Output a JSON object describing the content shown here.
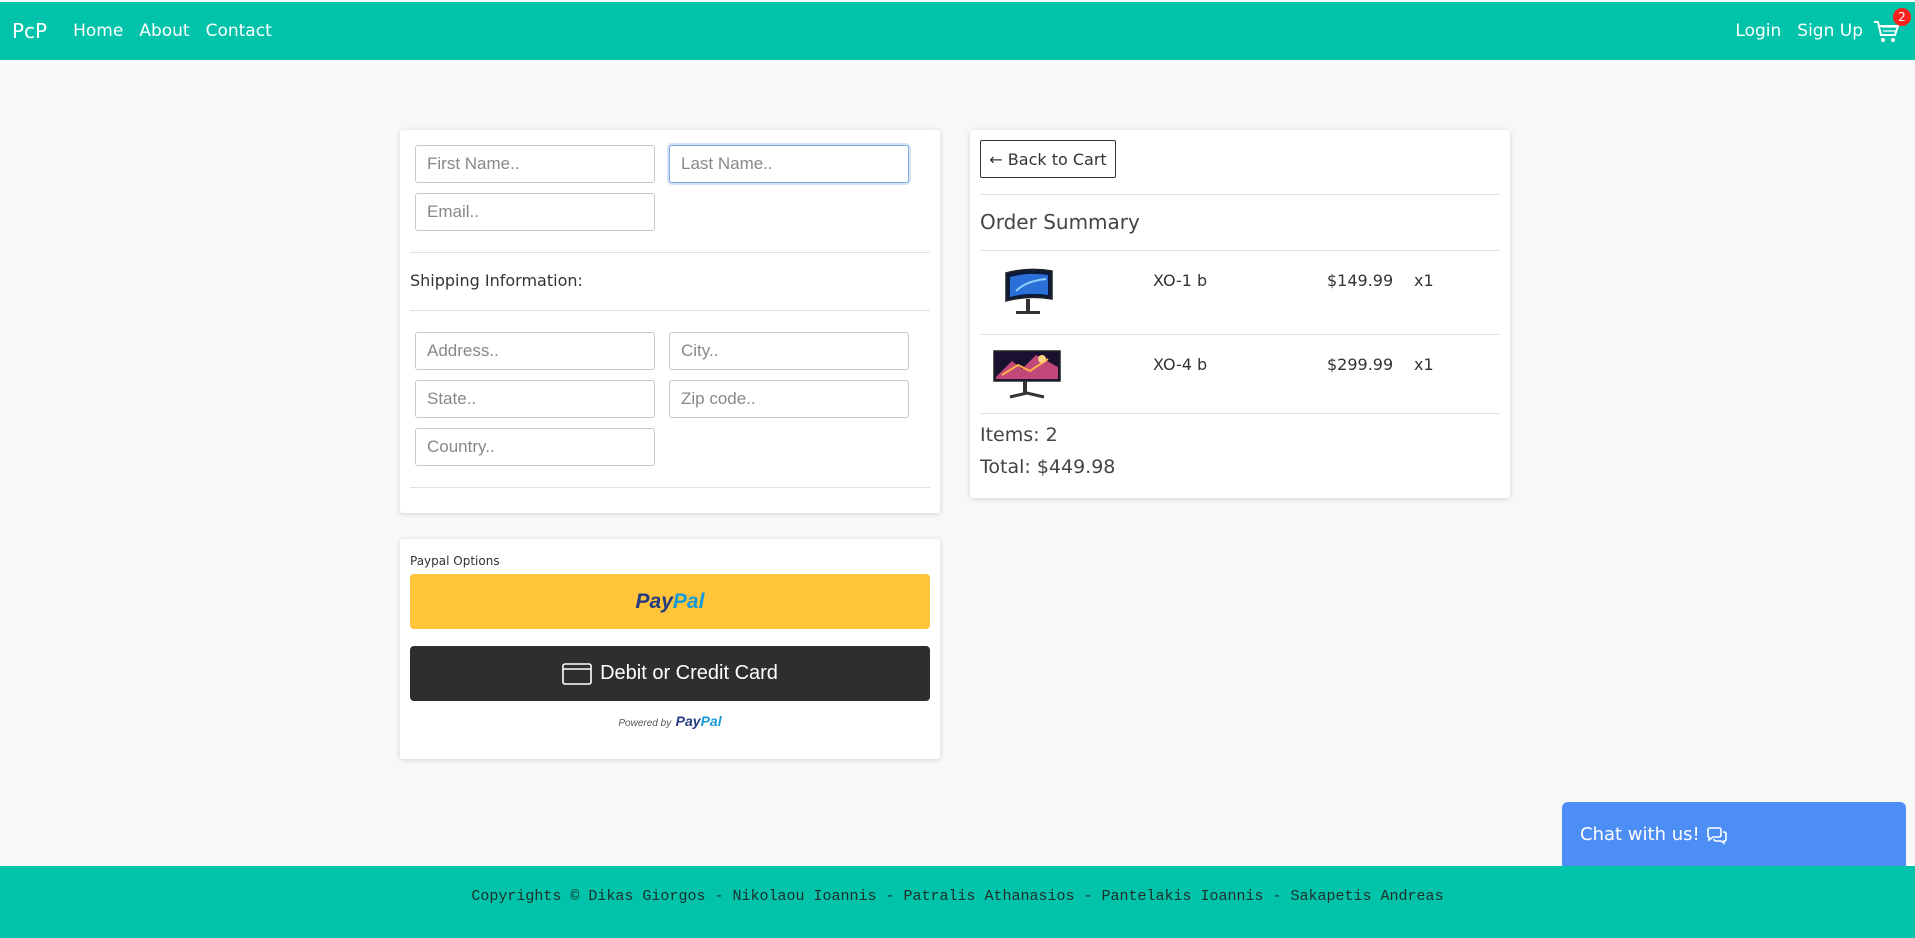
{
  "navbar": {
    "brand": "PcP",
    "links": [
      "Home",
      "About",
      "Contact"
    ],
    "right_links": [
      "Login",
      "Sign Up"
    ],
    "cart_icon": "cart-icon",
    "cart_count": "2"
  },
  "form": {
    "first_name_placeholder": "First Name..",
    "last_name_placeholder": "Last Name..",
    "email_placeholder": "Email..",
    "shipping_title": "Shipping Information:",
    "address_placeholder": "Address..",
    "city_placeholder": "City..",
    "state_placeholder": "State..",
    "zip_placeholder": "Zip code..",
    "country_placeholder": "Country.."
  },
  "payment": {
    "label": "Paypal Options",
    "paypal_part1": "Pay",
    "paypal_part2": "Pal",
    "card_button": "Debit or Credit Card",
    "powered_by": "Powered by",
    "powered_part1": "Pay",
    "powered_part2": "Pal"
  },
  "summary": {
    "back_button": "← Back to Cart",
    "title": "Order Summary",
    "items": [
      {
        "name": "XO-1 b",
        "price": "$149.99",
        "qty": "x1"
      },
      {
        "name": "XO-4 b",
        "price": "$299.99",
        "qty": "x1"
      }
    ],
    "items_count": "Items: 2",
    "total": "Total: $449.98"
  },
  "chat": {
    "label": "Chat with us!",
    "icon": "chat-icon"
  },
  "footer": {
    "text": "Copyrights © Dikas Giorgos - Nikolaou Ioannis - Patralis Athanasios - Pantelakis Ioannis - Sakapetis Andreas"
  },
  "colors": {
    "primary": "#00c3a9",
    "chat": "#4d8ef5",
    "paypal_yellow": "#ffc439",
    "badge": "#ff1f1f"
  }
}
